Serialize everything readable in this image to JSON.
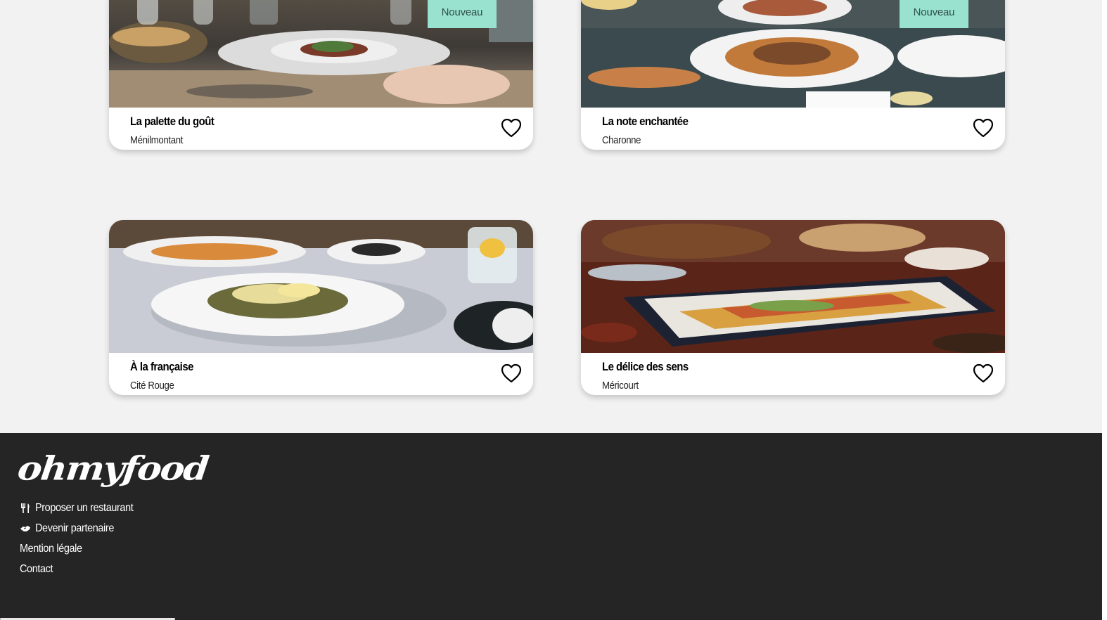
{
  "restaurants": [
    {
      "name": "La palette du goût",
      "location": "Ménilmontant",
      "badge": "Nouveau"
    },
    {
      "name": "La note enchantée",
      "location": "Charonne",
      "badge": "Nouveau"
    },
    {
      "name": "À la française",
      "location": "Cité Rouge",
      "badge": ""
    },
    {
      "name": "Le délice des sens",
      "location": "Méricourt",
      "badge": ""
    }
  ],
  "footer": {
    "logo": "ohmyfood",
    "links": [
      {
        "label": "Proposer un restaurant",
        "icon": "utensils-icon"
      },
      {
        "label": "Devenir partenaire",
        "icon": "handshake-icon"
      },
      {
        "label": "Mention légale",
        "icon": ""
      },
      {
        "label": "Contact",
        "icon": ""
      }
    ]
  },
  "colors": {
    "badge_bg": "#99e2d0",
    "footer_bg": "#252525",
    "page_bg": "#f2f2f2"
  }
}
